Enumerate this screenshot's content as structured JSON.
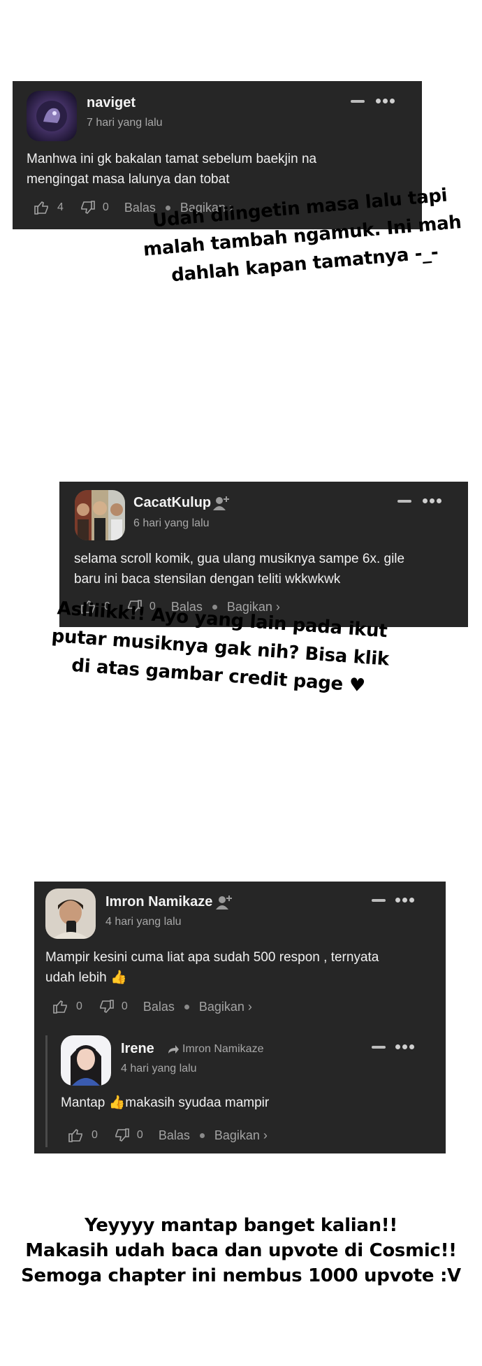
{
  "comments": [
    {
      "username": "naviget",
      "timestamp": "7 hari yang lalu",
      "body_lines": [
        "Manhwa ini gk bakalan tamat sebelum baekjin na",
        "mengingat masa lalunya dan tobat"
      ],
      "likes": "4",
      "dislikes": "0",
      "reply_label": "Balas",
      "share_label": "Bagikan ›"
    },
    {
      "username": "CacatKulup",
      "timestamp": "6 hari yang lalu",
      "body_lines": [
        "selama scroll komik, gua ulang musiknya sampe 6x. gile",
        "baru ini baca stensilan dengan teliti wkkwkwk"
      ],
      "likes": "0",
      "dislikes": "0",
      "reply_label": "Balas",
      "share_label": "Bagikan ›"
    },
    {
      "username": "Imron Namikaze",
      "timestamp": "4 hari yang lalu",
      "body_lines": [
        "Mampir kesini cuma liat apa sudah 500 respon , ternyata",
        "udah lebih 👍"
      ],
      "likes": "0",
      "dislikes": "0",
      "reply_label": "Balas",
      "share_label": "Bagikan ›",
      "reply": {
        "username": "Irene",
        "reply_to": "Imron Namikaze",
        "timestamp": "4 hari yang lalu",
        "body": "Mantap 👍makasih syudaa mampir",
        "likes": "0",
        "dislikes": "0",
        "reply_label": "Balas",
        "share_label": "Bagikan ›"
      }
    }
  ],
  "notes": {
    "note1": [
      "Udah diingetin masa lalu tapi",
      "malah tambah ngamuk. Ini mah",
      "dahlah kapan tamatnya -_-"
    ],
    "note2": [
      "Asliiikk!! Ayo yang lain pada ikut",
      "putar musiknya gak nih? Bisa klik",
      "di atas gambar credit page"
    ],
    "closing": [
      "Yeyyyy mantap banget kalian!!",
      "Makasih udah baca dan upvote di Cosmic!!",
      "Semoga chapter ini nembus 1000 upvote :V"
    ]
  },
  "colors": {
    "card_bg": "#262626",
    "text": "#f0f0f0",
    "muted": "#a8a8a8"
  }
}
